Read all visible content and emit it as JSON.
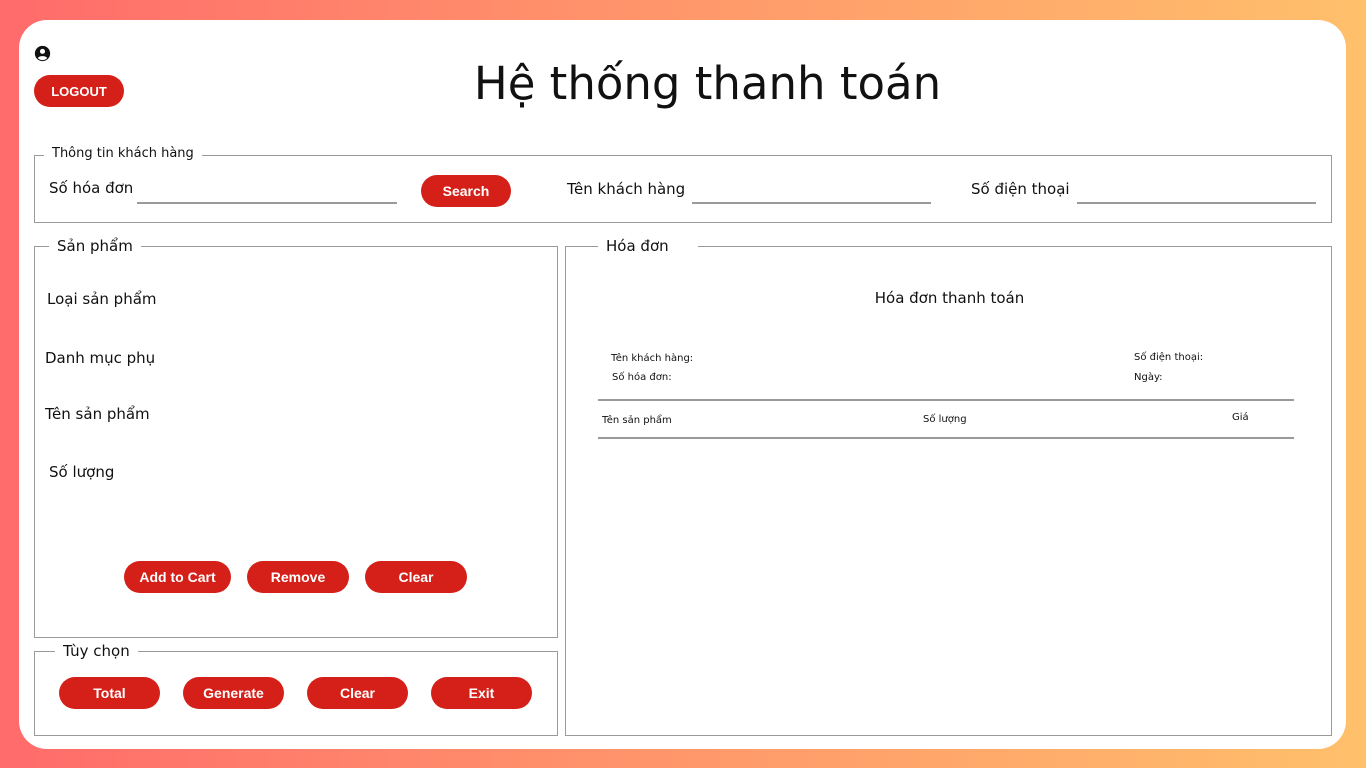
{
  "header": {
    "title": "Hệ thống thanh toán",
    "logout_label": "LOGOUT"
  },
  "customer": {
    "legend": "Thông tin khách hàng",
    "invoice_no_label": "Số hóa đơn",
    "invoice_no_value": "",
    "search_label": "Search",
    "name_label": "Tên khách hàng",
    "name_value": "",
    "phone_label": "Số điện thoại",
    "phone_value": ""
  },
  "products": {
    "legend": "Sản phẩm",
    "category_label": "Loại sản phẩm",
    "subcategory_label": "Danh mục phụ",
    "product_name_label": "Tên sản phẩm",
    "quantity_label": "Số lượng",
    "add_to_cart_label": "Add to Cart",
    "remove_label": "Remove",
    "clear_label": "Clear"
  },
  "options": {
    "legend": "Tùy chọn",
    "total_label": "Total",
    "generate_label": "Generate",
    "clear_label": "Clear",
    "exit_label": "Exit"
  },
  "invoice": {
    "legend": "Hóa đơn",
    "heading": "Hóa đơn thanh toán",
    "customer_name_label": "Tên khách hàng:",
    "invoice_no_label": "Số hóa đơn:",
    "phone_label": "Số điện thoại:",
    "date_label": "Ngày:",
    "columns": [
      "Tên sản phẩm",
      "Số lượng",
      "Giá"
    ]
  },
  "colors": {
    "accent": "#d42019",
    "border": "#9a9a9a"
  }
}
